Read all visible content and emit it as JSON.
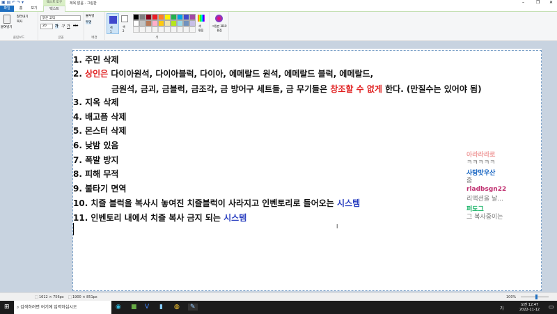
{
  "window": {
    "title": "제목 없음 - 그림판",
    "context_tab": "텍스트 도구",
    "minimize": "–",
    "restore": "❐",
    "close": "✕"
  },
  "tabs": [
    {
      "label": "파일"
    },
    {
      "label": "홈"
    },
    {
      "label": "보기"
    },
    {
      "label": "텍스트"
    }
  ],
  "ribbon": {
    "clipboard": {
      "paste": "붙여넣기",
      "cut": "잘라내기",
      "copy": "복사",
      "label": "클립보드"
    },
    "font": {
      "family": "맑은 고딕",
      "size": "20",
      "bold": "가",
      "italic": "가",
      "underline": "가",
      "strike": "abc",
      "label": "글꼴"
    },
    "background": {
      "opaque": "불투명",
      "transparent": "투명",
      "label": "배경"
    },
    "colors": {
      "color1": "색\n1",
      "color2": "색\n2",
      "edit": "색\n편집",
      "label": "색",
      "color1_value": "#3f48cc",
      "palette": [
        "#000000",
        "#7f7f7f",
        "#880015",
        "#ed1c24",
        "#ff7f27",
        "#fff200",
        "#22b14c",
        "#00a2e8",
        "#3f48cc",
        "#a349a4",
        "#ffffff",
        "#c3c3c3",
        "#b97a57",
        "#ffaec9",
        "#ffc90e",
        "#efe4b0",
        "#b5e61d",
        "#99d9ea",
        "#7092be",
        "#c8bfe7"
      ]
    },
    "paint3d": "그림판 3D로 편집"
  },
  "content": {
    "lines": [
      {
        "parts": [
          {
            "t": "1. 주민 삭제"
          }
        ]
      },
      {
        "parts": [
          {
            "t": "2. "
          },
          {
            "t": "상인은",
            "c": "red"
          },
          {
            "t": " 다이아원석, 다이아블럭, 다이아, 에메랄드 원석, 에메랄드 블럭, 에메랄드,"
          }
        ]
      },
      {
        "parts": [
          {
            "t": "금원석, 금괴, 금블럭, 금조각, 금 방어구 세트들, 금 무기들은 "
          },
          {
            "t": "창조할 수 없게",
            "c": "red"
          },
          {
            "t": " 한다. (만질수는 있어야 됨)"
          }
        ],
        "indent": true
      },
      {
        "parts": [
          {
            "t": "3. 지옥 삭제"
          }
        ]
      },
      {
        "parts": [
          {
            "t": "4. 배고픔 삭제"
          }
        ]
      },
      {
        "parts": [
          {
            "t": "5. 몬스터 삭제"
          }
        ]
      },
      {
        "parts": [
          {
            "t": "6. 낮밤 있음"
          }
        ]
      },
      {
        "parts": [
          {
            "t": "7. 폭발 방지"
          }
        ]
      },
      {
        "parts": [
          {
            "t": "8. 피해 무적"
          }
        ]
      },
      {
        "parts": [
          {
            "t": "9. 불타기 면역"
          }
        ]
      },
      {
        "parts": [
          {
            "t": "10. 치즐 블럭을 복사시 놓여진 치즐블럭이 사라지고 인벤토리로 들어오는 "
          },
          {
            "t": "시스템",
            "c": "blue"
          }
        ]
      },
      {
        "parts": [
          {
            "t": "11. 인벤토리 내에서 치즐 복사 금지 되는 "
          },
          {
            "t": "시스템",
            "c": "blue"
          }
        ]
      }
    ]
  },
  "chat": [
    {
      "name": "아라라라로",
      "msg": "ㅋㅋㅋㅋㅋ",
      "color": "#f0a0a0"
    },
    {
      "name": "사탕맛우산",
      "msg": "줌",
      "color": "#1060c0"
    },
    {
      "name": "rladbsgn22",
      "msg": "리액션을 날...",
      "color": "#c03070"
    },
    {
      "name": "퍼도그",
      "msg": "그 복사중이는",
      "color": "#10b060"
    }
  ],
  "status": {
    "selection": "1612 × 756px",
    "size": "1900 × 851px",
    "zoom": "100%"
  },
  "taskbar": {
    "search_placeholder": "검색하려면 여기에 입력하십시오",
    "time": "오전 12:47",
    "date": "2022-11-12",
    "ime": "가"
  }
}
